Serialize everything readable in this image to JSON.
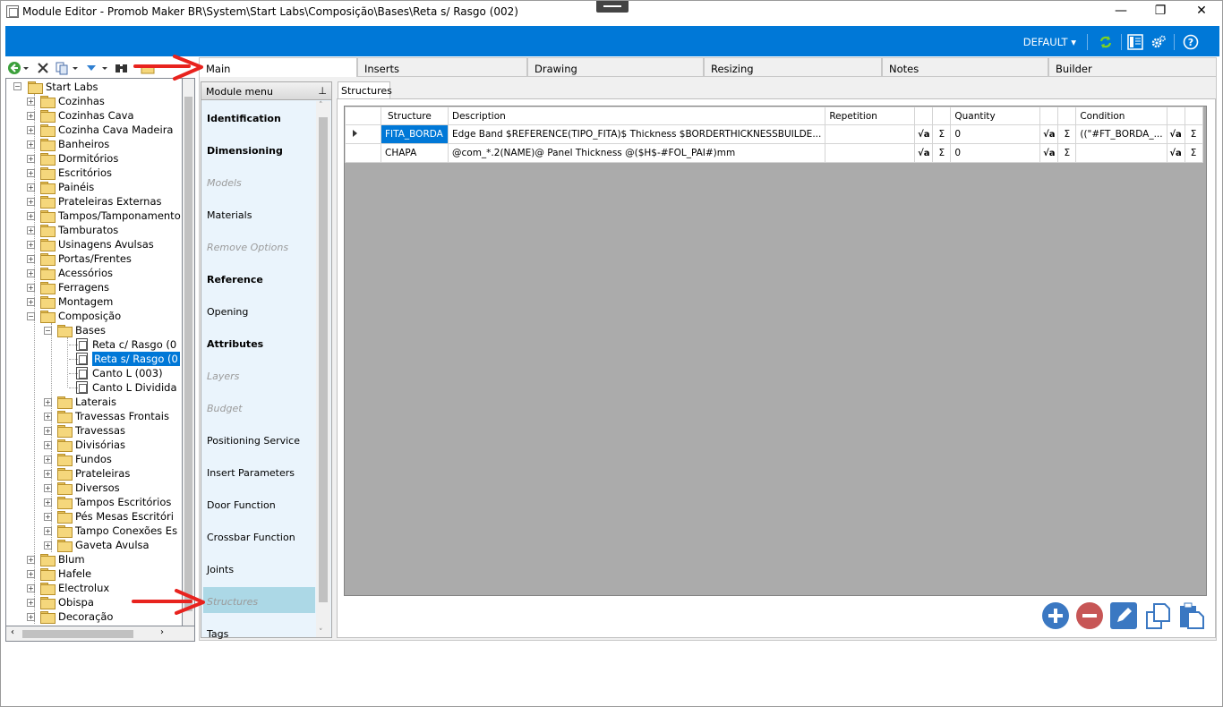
{
  "window": {
    "title": "Module Editor - Promob Maker BR\\System\\Start Labs\\Composição\\Bases\\Reta s/ Rasgo (002)",
    "controls": [
      "—",
      "❐",
      "✕"
    ]
  },
  "toolbar": {
    "workspace_label": "DEFAULT ▾",
    "icons": [
      "refresh-icon",
      "panel-layout-icon",
      "settings-icon",
      "help-icon"
    ]
  },
  "left_toolbar_icons": [
    "back-icon",
    "delete-icon",
    "copy-icon",
    "move-down-icon",
    "find-icon",
    "folder-icon"
  ],
  "tree": {
    "root": "Start Labs",
    "items": [
      {
        "label": "Cozinhas",
        "level": 1
      },
      {
        "label": "Cozinhas Cava",
        "level": 1
      },
      {
        "label": "Cozinha Cava Madeira",
        "level": 1
      },
      {
        "label": "Banheiros",
        "level": 1
      },
      {
        "label": "Dormitórios",
        "level": 1
      },
      {
        "label": "Escritórios",
        "level": 1
      },
      {
        "label": "Painéis",
        "level": 1
      },
      {
        "label": "Prateleiras Externas",
        "level": 1
      },
      {
        "label": "Tampos/Tamponamento",
        "level": 1
      },
      {
        "label": "Tamburatos",
        "level": 1
      },
      {
        "label": "Usinagens Avulsas",
        "level": 1
      },
      {
        "label": "Portas/Frentes",
        "level": 1
      },
      {
        "label": "Acessórios",
        "level": 1
      },
      {
        "label": "Ferragens",
        "level": 1
      },
      {
        "label": "Montagem",
        "level": 1
      },
      {
        "label": "Composição",
        "level": 1,
        "expanded": true
      },
      {
        "label": "Bases",
        "level": 2,
        "expanded": true
      },
      {
        "label": "Reta c/ Rasgo (0",
        "level": 3,
        "module": true
      },
      {
        "label": "Reta s/ Rasgo (0",
        "level": 3,
        "module": true,
        "selected": true
      },
      {
        "label": "Canto L (003)",
        "level": 3,
        "module": true
      },
      {
        "label": "Canto L Dividida",
        "level": 3,
        "module": true
      },
      {
        "label": "Laterais",
        "level": 2
      },
      {
        "label": "Travessas Frontais",
        "level": 2
      },
      {
        "label": "Travessas",
        "level": 2
      },
      {
        "label": "Divisórias",
        "level": 2
      },
      {
        "label": "Fundos",
        "level": 2
      },
      {
        "label": "Prateleiras",
        "level": 2
      },
      {
        "label": "Diversos",
        "level": 2
      },
      {
        "label": "Tampos Escritórios",
        "level": 2
      },
      {
        "label": "Pés Mesas Escritóri",
        "level": 2
      },
      {
        "label": "Tampo Conexões Es",
        "level": 2
      },
      {
        "label": "Gaveta Avulsa",
        "level": 2
      },
      {
        "label": "Blum",
        "level": 1
      },
      {
        "label": "Hafele",
        "level": 1
      },
      {
        "label": "Electrolux",
        "level": 1
      },
      {
        "label": "Obispa",
        "level": 1
      },
      {
        "label": "Decoração",
        "level": 1
      }
    ]
  },
  "tabs": [
    "Main",
    "Inserts",
    "Drawing",
    "Resizing",
    "Notes",
    "Builder"
  ],
  "module_menu": {
    "title": "Module menu",
    "pin": "⊥",
    "items": [
      {
        "label": "Identification",
        "style": "bold"
      },
      {
        "label": "Dimensioning",
        "style": "bold"
      },
      {
        "label": "Models",
        "style": "disabled"
      },
      {
        "label": "Materials",
        "style": "normal"
      },
      {
        "label": "Remove Options",
        "style": "disabled"
      },
      {
        "label": "Reference",
        "style": "bold"
      },
      {
        "label": "Opening",
        "style": "normal"
      },
      {
        "label": "Attributes",
        "style": "bold"
      },
      {
        "label": "Layers",
        "style": "disabled"
      },
      {
        "label": "Budget",
        "style": "disabled"
      },
      {
        "label": "Positioning Service",
        "style": "normal"
      },
      {
        "label": "Insert Parameters",
        "style": "normal"
      },
      {
        "label": "Door Function",
        "style": "normal"
      },
      {
        "label": "Crossbar Function",
        "style": "normal"
      },
      {
        "label": "Joints",
        "style": "normal"
      },
      {
        "label": "Structures",
        "style": "disabled",
        "selected": true
      },
      {
        "label": "Tags",
        "style": "normal"
      }
    ]
  },
  "structures": {
    "tab_label": "Structures",
    "columns": [
      "Structure",
      "Description",
      "Repetition",
      "Quantity",
      "Condition"
    ],
    "rows": [
      {
        "structure": "FITA_BORDA",
        "description": "Edge Band $REFERENCE(TIPO_FITA)$ Thickness $BORDERTHICKNESSBUILDE...",
        "repetition": "",
        "quantity": "0",
        "condition": "((\"#FT_BORDA_..."
      },
      {
        "structure": "CHAPA",
        "description": "@com_*.2(NAME)@ Panel Thickness @($H$-#FOL_PAI#)mm",
        "repetition": "",
        "quantity": "0",
        "condition": ""
      }
    ],
    "fx_symbol": "√a",
    "sigma_symbol": "Σ"
  },
  "action_buttons": [
    "add-icon",
    "remove-icon",
    "edit-icon",
    "duplicate-icon",
    "paste-icon"
  ],
  "colors": {
    "accent": "#0078d7",
    "menu_bg": "#eaf4fc",
    "menu_selected": "#acd8e6",
    "annotation_arrow": "#e8231e"
  }
}
